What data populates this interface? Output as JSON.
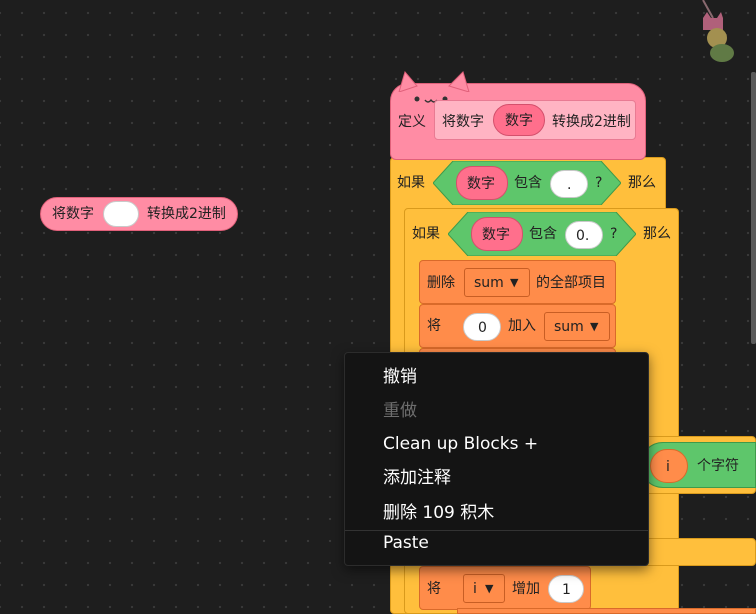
{
  "loose_block": {
    "prefix": "将数字",
    "suffix": "转换成2进制"
  },
  "define_block": {
    "keyword": "定义",
    "prefix": "将数字",
    "param": "数字",
    "suffix": "转换成2进制"
  },
  "if_block_1": {
    "keyword_if": "如果",
    "param": "数字",
    "contains": "包含",
    "value": ".",
    "question": "?",
    "keyword_then": "那么"
  },
  "if_block_2": {
    "keyword_if": "如果",
    "param": "数字",
    "contains": "包含",
    "value": "0.",
    "question": "?",
    "keyword_then": "那么"
  },
  "delete_block": {
    "keyword": "删除",
    "list": "sum",
    "suffix": "的全部项目"
  },
  "add_block": {
    "keyword": "将",
    "value": "0",
    "middle": "加入",
    "list": "sum"
  },
  "char_block": {
    "var": "i",
    "suffix": "个字符"
  },
  "increase_block": {
    "keyword": "将",
    "var": "i",
    "middle": "增加",
    "value": "1"
  },
  "context_menu": {
    "items": [
      {
        "label": "撤销",
        "enabled": true
      },
      {
        "label": "重做",
        "enabled": false
      },
      {
        "label": "Clean up Blocks +",
        "enabled": true
      },
      {
        "label": "添加注释",
        "enabled": true
      },
      {
        "label": "删除 109 积木",
        "enabled": true
      },
      {
        "label": "Paste",
        "enabled": true
      }
    ]
  },
  "colors": {
    "background": "#1e1e1e",
    "my_blocks": "#ff8ca4",
    "control": "#ffbf3c",
    "operators": "#5ec66b",
    "list": "#ff8c4a",
    "menu_bg": "#141414"
  }
}
